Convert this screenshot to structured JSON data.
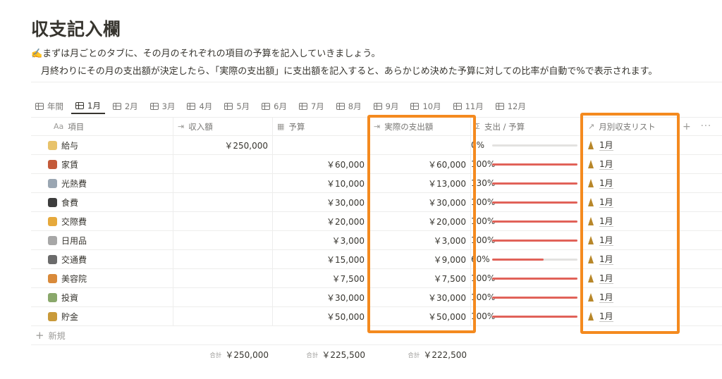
{
  "page": {
    "title": "収支記入欄",
    "desc_line1": "✍️まずは月ごとのタブに、その月のそれぞれの項目の予算を記入していきましょう。",
    "desc_line2": "月終わりにその月の支出額が決定したら、「実際の支出額」に支出額を記入すると、あらかじめ決めた予算に対しての比率が自動で%で表示されます。"
  },
  "tabs": [
    {
      "label": "年間"
    },
    {
      "label": "1月"
    },
    {
      "label": "2月"
    },
    {
      "label": "3月"
    },
    {
      "label": "4月"
    },
    {
      "label": "5月"
    },
    {
      "label": "6月"
    },
    {
      "label": "7月"
    },
    {
      "label": "8月"
    },
    {
      "label": "9月"
    },
    {
      "label": "10月"
    },
    {
      "label": "11月"
    },
    {
      "label": "12月"
    }
  ],
  "active_tab": "1月",
  "columns": {
    "item": {
      "icon": "Aa",
      "label": "項目"
    },
    "income": {
      "icon": "⇥",
      "label": "収入額"
    },
    "budget": {
      "icon": "▦",
      "label": "予算"
    },
    "actual": {
      "icon": "⇥",
      "label": "実際の支出額"
    },
    "ratio": {
      "icon": "Σ",
      "label": "支出 / 予算"
    },
    "relation": {
      "icon": "↗",
      "label": "月別収支リスト"
    },
    "add": "+",
    "more": "···"
  },
  "rows": [
    {
      "emoji_color": "#e8c36b",
      "name": "給与",
      "income": "￥250,000",
      "budget": "",
      "actual": "",
      "pct": "0%",
      "ratio": 0,
      "relation": "1月"
    },
    {
      "emoji_color": "#c45a3a",
      "name": "家賃",
      "income": "",
      "budget": "￥60,000",
      "actual": "￥60,000",
      "pct": "100%",
      "ratio": 1.0,
      "relation": "1月"
    },
    {
      "emoji_color": "#9aa6b2",
      "name": "光熱費",
      "income": "",
      "budget": "￥10,000",
      "actual": "￥13,000",
      "pct": "130%",
      "ratio": 1.0,
      "relation": "1月"
    },
    {
      "emoji_color": "#3d3d3d",
      "name": "食費",
      "income": "",
      "budget": "￥30,000",
      "actual": "￥30,000",
      "pct": "100%",
      "ratio": 1.0,
      "relation": "1月"
    },
    {
      "emoji_color": "#e6a93c",
      "name": "交際費",
      "income": "",
      "budget": "￥20,000",
      "actual": "￥20,000",
      "pct": "100%",
      "ratio": 1.0,
      "relation": "1月"
    },
    {
      "emoji_color": "#a7a7a7",
      "name": "日用品",
      "income": "",
      "budget": "￥3,000",
      "actual": "￥3,000",
      "pct": "100%",
      "ratio": 1.0,
      "relation": "1月"
    },
    {
      "emoji_color": "#6b6b6b",
      "name": "交通費",
      "income": "",
      "budget": "￥15,000",
      "actual": "￥9,000",
      "pct": "60%",
      "ratio": 0.6,
      "relation": "1月"
    },
    {
      "emoji_color": "#d98a3a",
      "name": "美容院",
      "income": "",
      "budget": "￥7,500",
      "actual": "￥7,500",
      "pct": "100%",
      "ratio": 1.0,
      "relation": "1月"
    },
    {
      "emoji_color": "#8aa86b",
      "name": "投資",
      "income": "",
      "budget": "￥30,000",
      "actual": "￥30,000",
      "pct": "100%",
      "ratio": 1.0,
      "relation": "1月"
    },
    {
      "emoji_color": "#c99a3a",
      "name": "貯金",
      "income": "",
      "budget": "￥50,000",
      "actual": "￥50,000",
      "pct": "100%",
      "ratio": 1.0,
      "relation": "1月"
    }
  ],
  "new_row_label": "新規",
  "totals": {
    "label": "合計",
    "income": "￥250,000",
    "budget": "￥225,500",
    "actual": "￥222,500"
  },
  "colors": {
    "highlight": "#f48a1f",
    "bar_fill": "#e16259",
    "bar_track": "#e3e2e0"
  }
}
